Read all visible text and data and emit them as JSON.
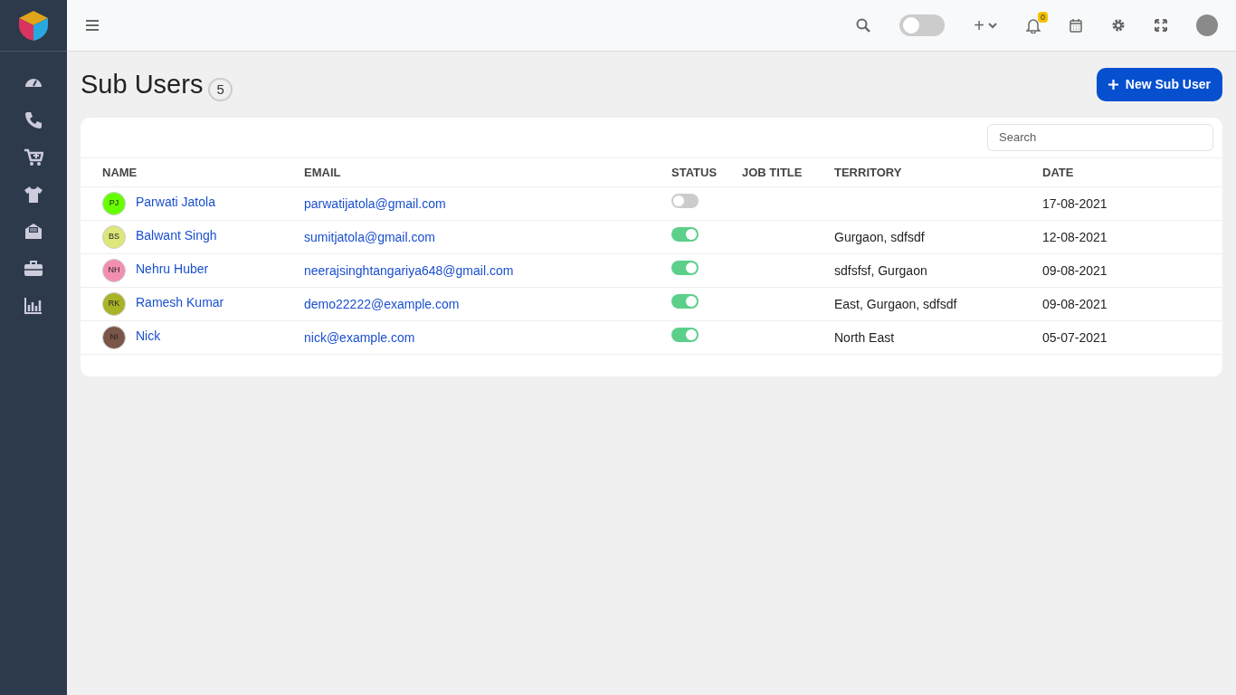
{
  "topbar": {
    "theme_toggle": {
      "on": false
    },
    "notifications": {
      "count": "0"
    },
    "add_menu": {
      "label": "+"
    }
  },
  "page": {
    "title": "Sub Users",
    "count": "5",
    "new_button": "New Sub User"
  },
  "table": {
    "search": {
      "placeholder": "Search"
    },
    "columns": [
      "NAME",
      "EMAIL",
      "STATUS",
      "JOB TITLE",
      "TERRITORY",
      "DATE"
    ],
    "rows": [
      {
        "initials": "PJ",
        "color": "#66ff00",
        "name": "Parwati Jatola",
        "email": "parwatijatola@gmail.com",
        "on": false,
        "job_title": "",
        "territory": "",
        "date": "17-08-2021"
      },
      {
        "initials": "BS",
        "color": "#dde77a",
        "name": "Balwant Singh",
        "email": "sumitjatola@gmail.com",
        "on": true,
        "job_title": "",
        "territory": "Gurgaon, sdfsdf",
        "date": "12-08-2021"
      },
      {
        "initials": "NH",
        "color": "#f28fb0",
        "name": "Nehru Huber",
        "email": "neerajsinghtangariya648@gmail.com",
        "on": true,
        "job_title": "",
        "territory": "sdfsfsf, Gurgaon",
        "date": "09-08-2021"
      },
      {
        "initials": "RK",
        "color": "#a9b326",
        "name": "Ramesh Kumar",
        "email": "demo22222@example.com",
        "on": true,
        "job_title": "",
        "territory": "East, Gurgaon, sdfsdf",
        "date": "09-08-2021"
      },
      {
        "initials": "NI",
        "color": "#7a5548",
        "name": "Nick",
        "email": "nick@example.com",
        "on": true,
        "job_title": "",
        "territory": "North East",
        "date": "05-07-2021"
      }
    ]
  }
}
